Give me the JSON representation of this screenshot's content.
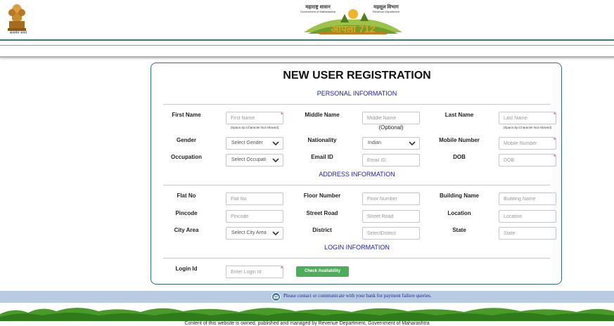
{
  "header": {
    "emblem_caption": "सत्यमेव जयते",
    "logo_left_line1": "महाराष्ट्र शासन",
    "logo_left_line2": "Government of Maharashtra",
    "logo_right_line1": "महसूल विभाग",
    "logo_right_line2": "Revenue Department",
    "logo_mark": "आपला 712"
  },
  "form": {
    "title": "NEW USER REGISTRATION",
    "sections": {
      "personal": "PERSONAL INFORMATION",
      "address": "ADDRESS INFORMATION",
      "login": "LOGIN INFORMATION"
    },
    "fields": {
      "first_name": {
        "label": "First Name",
        "placeholder": "First Name",
        "hint": "(Space,Sp.Character Not Allowed)"
      },
      "middle_name": {
        "label": "Middle Name",
        "placeholder": "Middle Name",
        "note": "(Optional)"
      },
      "last_name": {
        "label": "Last Name",
        "placeholder": "Last Name",
        "hint": "(Space,Sp.Character Not Allowed)"
      },
      "gender": {
        "label": "Gender",
        "value": "Select Gender"
      },
      "nationality": {
        "label": "Nationality",
        "value": "Indian"
      },
      "mobile": {
        "label": "Mobile Number",
        "placeholder": "Mobile Number"
      },
      "occupation": {
        "label": "Occupation",
        "value": "Select Occupati"
      },
      "email": {
        "label": "Email ID",
        "placeholder": "Email ID"
      },
      "dob": {
        "label": "DOB",
        "placeholder": "DOB"
      },
      "flat": {
        "label": "Flat No",
        "placeholder": "Flat No"
      },
      "floor": {
        "label": "Floor Number",
        "placeholder": "Floor Number"
      },
      "building": {
        "label": "Building Name",
        "placeholder": "Building Name"
      },
      "pincode": {
        "label": "Pincode",
        "placeholder": "Pincode"
      },
      "street": {
        "label": "Street Road",
        "placeholder": "Street Road"
      },
      "location": {
        "label": "Location",
        "placeholder": "Location"
      },
      "city_area": {
        "label": "City Area",
        "value": "Select City Area"
      },
      "district": {
        "label": "District",
        "placeholder": "SelectDistrict"
      },
      "state": {
        "label": "State",
        "placeholder": "State"
      },
      "login_id": {
        "label": "Login Id",
        "placeholder": "Enter Login Id"
      }
    },
    "required_mark": "*",
    "check_button": "Check Availability"
  },
  "notice": {
    "text": "Please contact or communicate with your bank for payment failure queries."
  },
  "footer": {
    "text": "Content of this website is owned, published and managed by Revenue Department, Government of Maharashtra"
  },
  "colors": {
    "accent": "#2f6d86",
    "section": "#1a1aa8",
    "button": "#4cae5a",
    "notice_bg": "#b7cbe2",
    "required": "#e02020"
  },
  "icons": [
    "emblem-icon",
    "chevron-down-icon",
    "info-icon",
    "grass-banner"
  ]
}
